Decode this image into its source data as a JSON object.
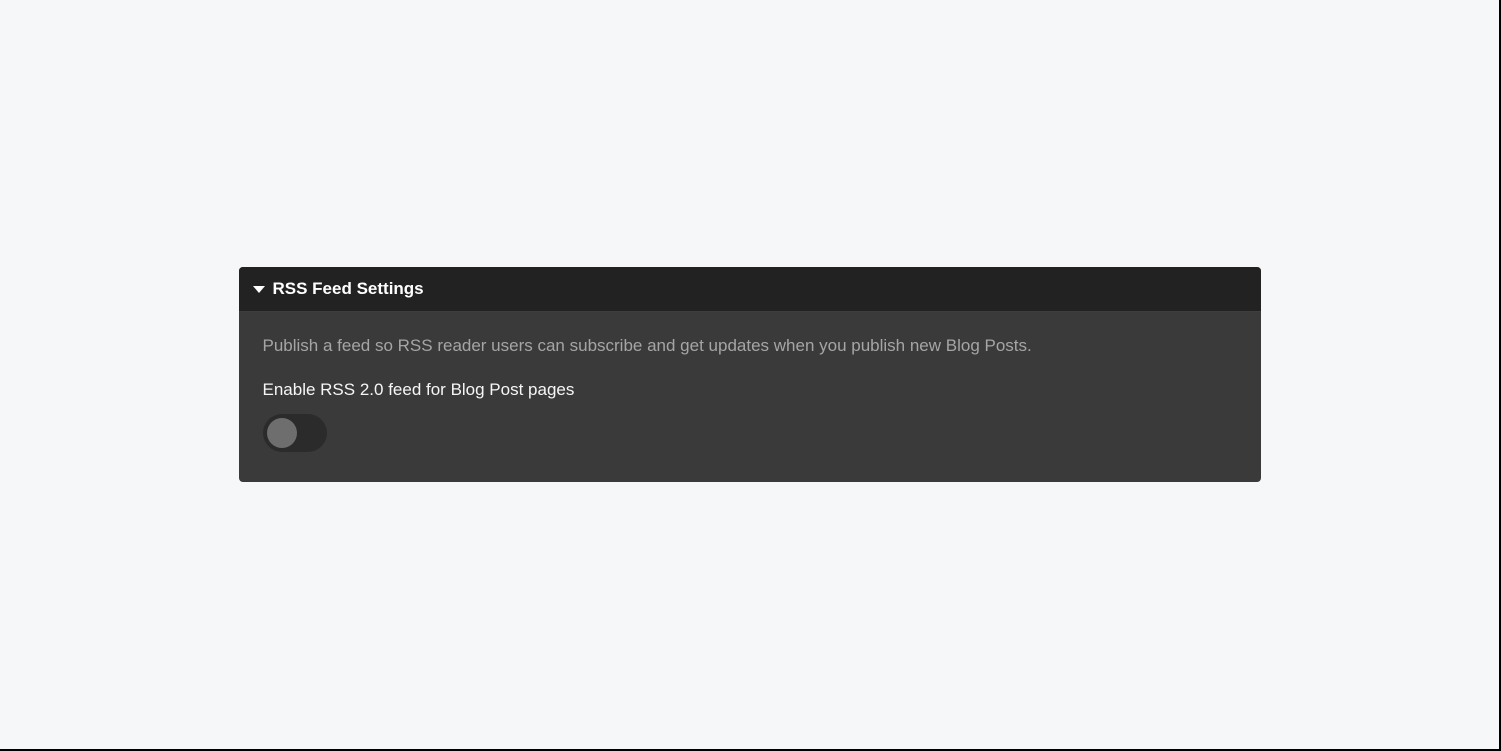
{
  "panel": {
    "title": "RSS Feed Settings",
    "description": "Publish a feed so RSS reader users can subscribe and get updates when you publish new Blog Posts.",
    "setting_label": "Enable RSS 2.0 feed for Blog Post pages",
    "toggle_enabled": false
  }
}
